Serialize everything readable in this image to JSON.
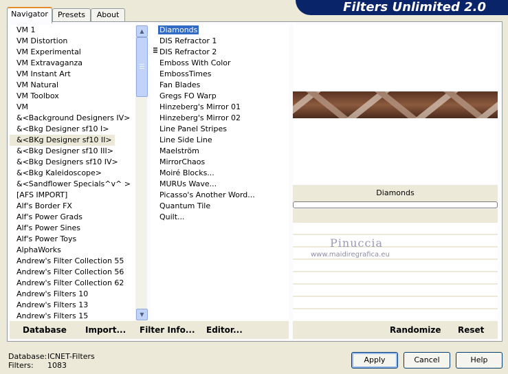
{
  "tabs": [
    "Navigator",
    "Presets",
    "About"
  ],
  "banner_title": "Filters Unlimited 2.0",
  "categories": [
    "VM 1",
    "VM Distortion",
    "VM Experimental",
    "VM Extravaganza",
    "VM Instant Art",
    "VM Natural",
    "VM Toolbox",
    "VM",
    "&<Background Designers IV>",
    "&<Bkg Designer sf10 I>",
    "&<BKg Designer sf10 II>",
    "&<Bkg Designer sf10 III>",
    "&<Bkg Designers sf10 IV>",
    "&<Bkg Kaleidoscope>",
    "&<Sandflower Specials^v^ >",
    "[AFS IMPORT]",
    "Alf's Border FX",
    "Alf's Power Grads",
    "Alf's Power Sines",
    "Alf's Power Toys",
    "AlphaWorks",
    "Andrew's Filter Collection 55",
    "Andrew's Filter Collection 56",
    "Andrew's Filter Collection 62",
    "Andrew's Filters 10",
    "Andrew's Filters 13",
    "Andrew's Filters 15"
  ],
  "selected_category": "&<BKg Designer sf10 II>",
  "filters": [
    "Diamonds",
    "DIS Refractor 1",
    "DIS Refractor 2",
    "Emboss With Color",
    "EmbossTimes",
    "Fan Blades",
    "Gregs FO Warp",
    "Hinzeberg's Mirror 01",
    "Hinzeberg's Mirror 02",
    "Line Panel Stripes",
    "Line Side Line",
    "Maelström",
    "MirrorChaos",
    "Moiré Blocks...",
    "MURUs Wave...",
    "Picasso's Another Word...",
    "Quantum Tile",
    "Quilt..."
  ],
  "selected_filter": "Diamonds",
  "preview_filter_name": "Diamonds",
  "watermark": {
    "line1": "Pinuccia",
    "line2": "www.maidiregrafica.eu"
  },
  "bottom_left_buttons": [
    "Database",
    "Import...",
    "Filter Info...",
    "Editor..."
  ],
  "bottom_right_buttons": [
    "Randomize",
    "Reset"
  ],
  "status": {
    "database_label": "Database:",
    "database_value": "ICNET-Filters",
    "filters_label": "Filters:",
    "filters_value": "1083"
  },
  "dialog_buttons": {
    "apply": "Apply",
    "cancel": "Cancel",
    "help": "Help"
  },
  "colors": {
    "accent": "#316ac5",
    "banner": "#0a246a",
    "face": "#ece9d8"
  },
  "icons": {
    "scroll_up": "scroll-up-arrow-icon",
    "scroll_down": "scroll-down-arrow-icon"
  }
}
